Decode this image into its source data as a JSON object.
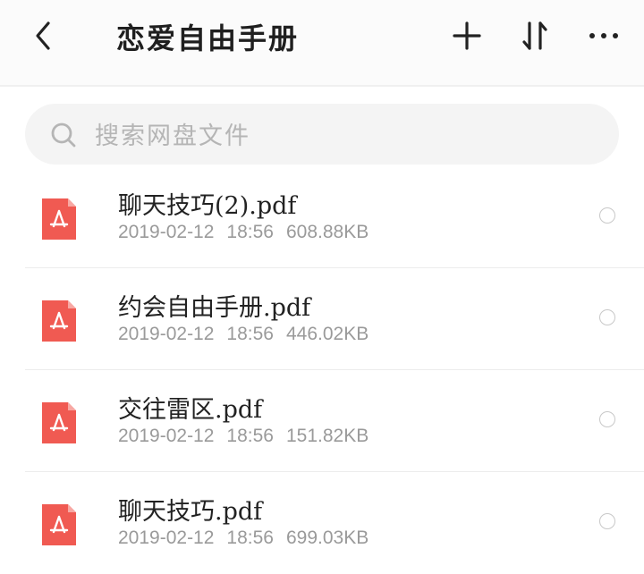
{
  "header": {
    "title": "恋爱自由手册",
    "back_icon": "chevron-left-icon",
    "add_icon": "plus-icon",
    "sort_icon": "sort-arrows-icon",
    "more_icon": "more-horizontal-icon"
  },
  "search": {
    "placeholder": "搜索网盘文件",
    "icon": "search-icon"
  },
  "files": [
    {
      "name": "聊天技巧(2).pdf",
      "date": "2019-02-12",
      "time": "18:56",
      "size": "608.88KB"
    },
    {
      "name": "约会自由手册.pdf",
      "date": "2019-02-12",
      "time": "18:56",
      "size": "446.02KB"
    },
    {
      "name": "交往雷区.pdf",
      "date": "2019-02-12",
      "time": "18:56",
      "size": "151.82KB"
    },
    {
      "name": "聊天技巧.pdf",
      "date": "2019-02-12",
      "time": "18:56",
      "size": "699.03KB"
    }
  ],
  "colors": {
    "pdf_red": "#f05a52",
    "meta_gray": "#9a9a9a",
    "search_bg": "#f4f4f4"
  }
}
